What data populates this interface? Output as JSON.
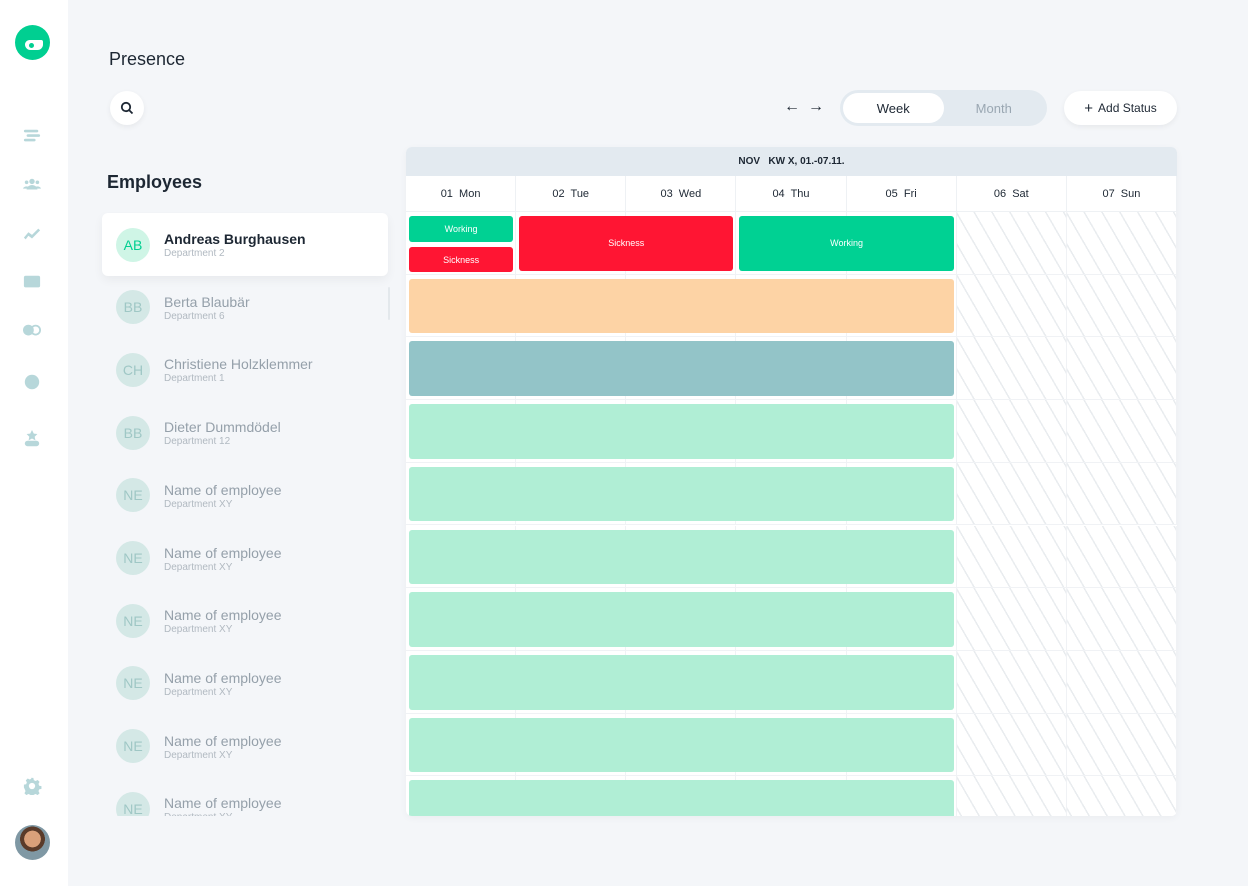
{
  "page": {
    "title": "Presence"
  },
  "sidebar": {
    "icons": [
      "menu-icon",
      "team-icon",
      "chart-icon",
      "card-icon",
      "toggle-icon",
      "clock-icon",
      "award-icon"
    ],
    "settings_icon": "gear-icon"
  },
  "toolbar": {
    "prev": "←",
    "next": "→",
    "week": "Week",
    "month": "Month",
    "add_status": "Add Status",
    "add_icon": "+"
  },
  "employees": {
    "title": "Employees",
    "items": [
      {
        "initials": "AB",
        "name": "Andreas Burghausen",
        "dept": "Department 2"
      },
      {
        "initials": "BB",
        "name": "Berta Blaubär",
        "dept": "Department 6"
      },
      {
        "initials": "CH",
        "name": "Christiene Holzklemmer",
        "dept": "Department 1"
      },
      {
        "initials": "BB",
        "name": "Dieter Dummdödel",
        "dept": "Department 12"
      },
      {
        "initials": "NE",
        "name": "Name of employee",
        "dept": "Department XY"
      },
      {
        "initials": "NE",
        "name": "Name of employee",
        "dept": "Department XY"
      },
      {
        "initials": "NE",
        "name": "Name of employee",
        "dept": "Department XY"
      },
      {
        "initials": "NE",
        "name": "Name of employee",
        "dept": "Department XY"
      },
      {
        "initials": "NE",
        "name": "Name of employee",
        "dept": "Department XY"
      },
      {
        "initials": "NE",
        "name": "Name of employee",
        "dept": "Department XY"
      }
    ]
  },
  "calendar": {
    "header": "NOV   KW X, 01.-07.11.",
    "days": [
      "01  Mon",
      "02  Tue",
      "03  Wed",
      "04  Thu",
      "05  Fri",
      "06  Sat",
      "07  Sun"
    ],
    "colors": {
      "working": "#00d193",
      "sickness": "#ff1533",
      "orange": "#fdd3a5",
      "teal": "#93c4c8",
      "mint": "#b0eed5"
    },
    "blocks": [
      {
        "row": 0,
        "start": 0,
        "end": 0,
        "half": "top",
        "label": "Working",
        "color": "working"
      },
      {
        "row": 0,
        "start": 0,
        "end": 0,
        "half": "bottom",
        "label": "Sickness",
        "color": "sickness"
      },
      {
        "row": 0,
        "start": 1,
        "end": 2,
        "label": "Sickness",
        "color": "sickness"
      },
      {
        "row": 0,
        "start": 3,
        "end": 4,
        "label": "Working",
        "color": "working"
      },
      {
        "row": 1,
        "start": 0,
        "end": 4,
        "label": "",
        "color": "orange"
      },
      {
        "row": 2,
        "start": 0,
        "end": 4,
        "label": "",
        "color": "teal"
      },
      {
        "row": 3,
        "start": 0,
        "end": 4,
        "label": "",
        "color": "mint"
      },
      {
        "row": 4,
        "start": 0,
        "end": 4,
        "label": "",
        "color": "mint"
      },
      {
        "row": 5,
        "start": 0,
        "end": 4,
        "label": "",
        "color": "mint"
      },
      {
        "row": 6,
        "start": 0,
        "end": 4,
        "label": "",
        "color": "mint"
      },
      {
        "row": 7,
        "start": 0,
        "end": 4,
        "label": "",
        "color": "mint"
      },
      {
        "row": 8,
        "start": 0,
        "end": 4,
        "label": "",
        "color": "mint"
      },
      {
        "row": 9,
        "start": 0,
        "end": 4,
        "label": "",
        "color": "mint"
      }
    ]
  }
}
